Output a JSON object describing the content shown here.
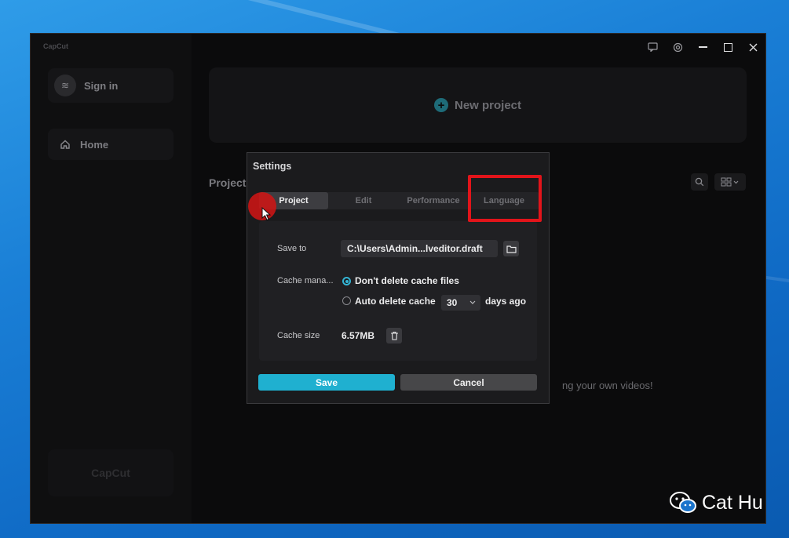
{
  "app": {
    "brand": "CapCut",
    "sidebar": {
      "sign_in": "Sign in",
      "home": "Home",
      "footer_brand": "CapCut"
    },
    "titlebar": {
      "icons": [
        "feedback-icon",
        "settings-icon",
        "minimize-icon",
        "maximize-icon",
        "close-icon"
      ]
    },
    "main": {
      "new_project": "New project",
      "projects_heading": "Projects",
      "empty_hint": "ng your own videos!"
    }
  },
  "settings_dialog": {
    "title": "Settings",
    "tabs": [
      {
        "label": "Project",
        "active": true
      },
      {
        "label": "Edit",
        "active": false
      },
      {
        "label": "Performance",
        "active": false
      },
      {
        "label": "Language",
        "active": false
      }
    ],
    "save_to": {
      "label": "Save to",
      "value": "C:\\Users\\Admin...lveditor.draft"
    },
    "cache_management": {
      "label": "Cache mana...",
      "options": [
        {
          "label": "Don't delete cache files",
          "selected": true
        },
        {
          "label": "Auto delete cache",
          "selected": false
        }
      ],
      "days_value": "30",
      "days_suffix": "days ago"
    },
    "cache_size": {
      "label": "Cache size",
      "value": "6.57MB"
    },
    "buttons": {
      "save": "Save",
      "cancel": "Cancel"
    }
  },
  "watermark": {
    "text": "Cat Hu"
  },
  "colors": {
    "accent": "#1fb0d0",
    "annotation_red": "#e2141a",
    "dialog_bg": "#1b1b1d",
    "app_bg": "#0b0b0c"
  }
}
